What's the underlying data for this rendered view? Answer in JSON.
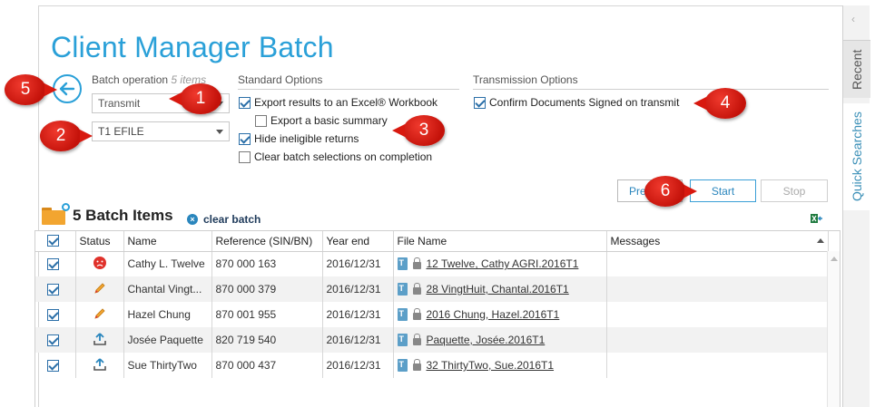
{
  "title": "Client Manager Batch",
  "right_panel": {
    "recent": "Recent",
    "quick_searches": "Quick Searches"
  },
  "batch_operation": {
    "label": "Batch operation",
    "count_text": "5 items",
    "operation_value": "Transmit",
    "type_value": "T1 EFILE"
  },
  "standard_options": {
    "label": "Standard Options",
    "export_excel": "Export results to an Excel® Workbook",
    "export_summary": "Export a basic summary",
    "hide_ineligible": "Hide ineligible returns",
    "clear_selections": "Clear batch selections on completion"
  },
  "transmission_options": {
    "label": "Transmission Options",
    "confirm_signed": "Confirm Documents Signed on transmit"
  },
  "buttons": {
    "preview": "Pre",
    "start": "Start",
    "stop": "Stop"
  },
  "callouts": [
    "1",
    "2",
    "3",
    "4",
    "5",
    "6"
  ],
  "items": {
    "title": "5 Batch Items",
    "clear_batch": "clear batch"
  },
  "table": {
    "headers": [
      "Status",
      "Name",
      "Reference (SIN/BN)",
      "Year end",
      "File Name",
      "Messages"
    ],
    "rows": [
      {
        "status": "error",
        "name": "Cathy L. Twelve",
        "ref": "870 000 163",
        "year": "2016/12/31",
        "file": "12 Twelve, Cathy AGRI.2016T1"
      },
      {
        "status": "edit",
        "name": "Chantal Vingt...",
        "ref": "870 000 379",
        "year": "2016/12/31",
        "file": "28 VingtHuit, Chantal.2016T1"
      },
      {
        "status": "edit",
        "name": "Hazel Chung",
        "ref": "870 001 955",
        "year": "2016/12/31",
        "file": "2016 Chung, Hazel.2016T1"
      },
      {
        "status": "upload",
        "name": "Josée Paquette",
        "ref": "820 719 540",
        "year": "2016/12/31",
        "file": "Paquette, Josée.2016T1"
      },
      {
        "status": "upload",
        "name": "Sue ThirtyTwo",
        "ref": "870 000 437",
        "year": "2016/12/31",
        "file": "32 ThirtyTwo, Sue.2016T1"
      }
    ]
  },
  "colors": {
    "accent": "#2aa0d8",
    "callout": "#d8190f"
  }
}
